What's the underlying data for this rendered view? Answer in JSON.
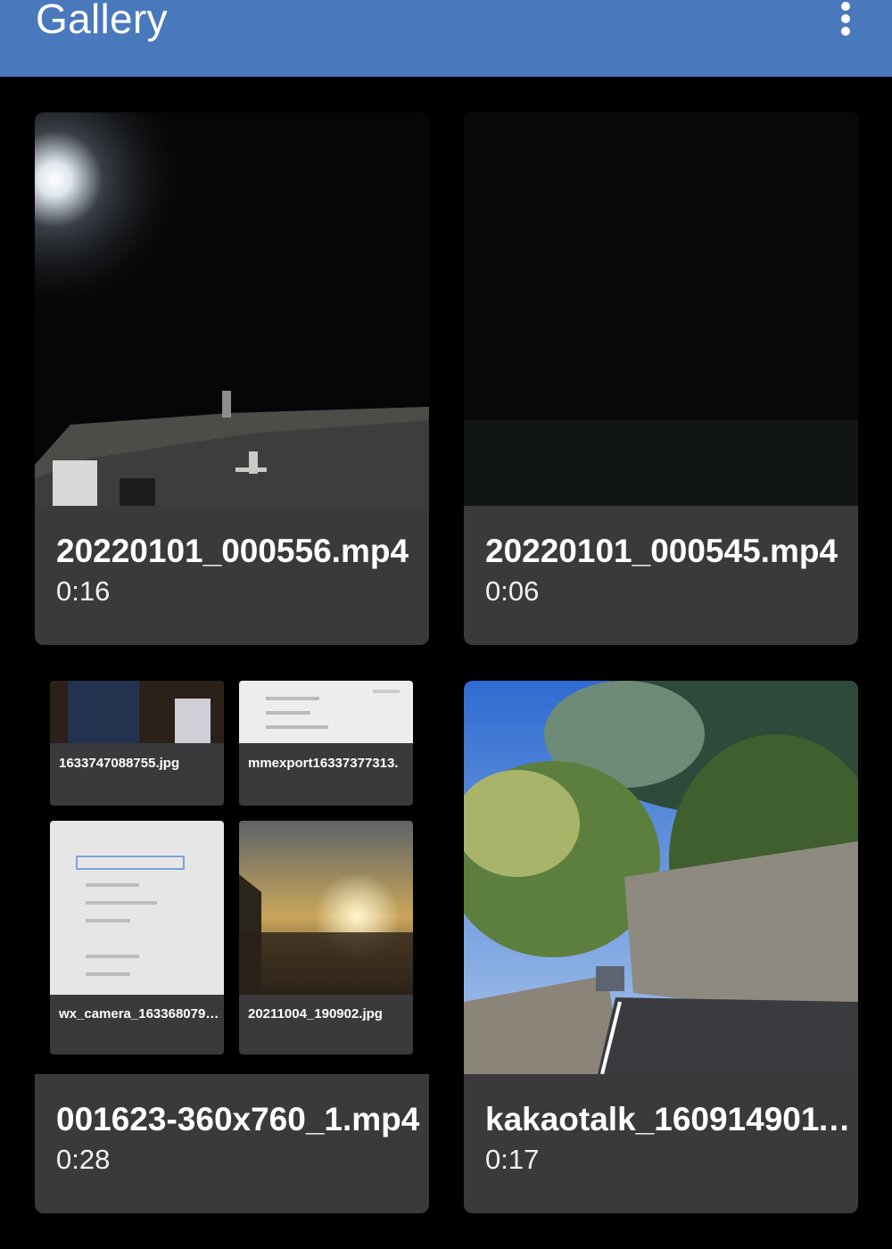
{
  "app_bar": {
    "title": "Gallery",
    "overflow_icon": "more-vert-icon",
    "color": "#4a78bd"
  },
  "items": [
    {
      "name": "20220101_000556.mp4",
      "duration": "0:16"
    },
    {
      "name": "20220101_000545.mp4",
      "duration": "0:06"
    },
    {
      "name": "001623-360x760_1.mp4",
      "duration": "0:28"
    },
    {
      "name": "kakaotalk_1609149011…",
      "duration": "0:17"
    }
  ],
  "album_tiles": [
    {
      "label": "1633747088755.jpg"
    },
    {
      "label": "mmexport16337377313."
    },
    {
      "label": "wx_camera_163368079…"
    },
    {
      "label": "20211004_190902.jpg"
    }
  ]
}
